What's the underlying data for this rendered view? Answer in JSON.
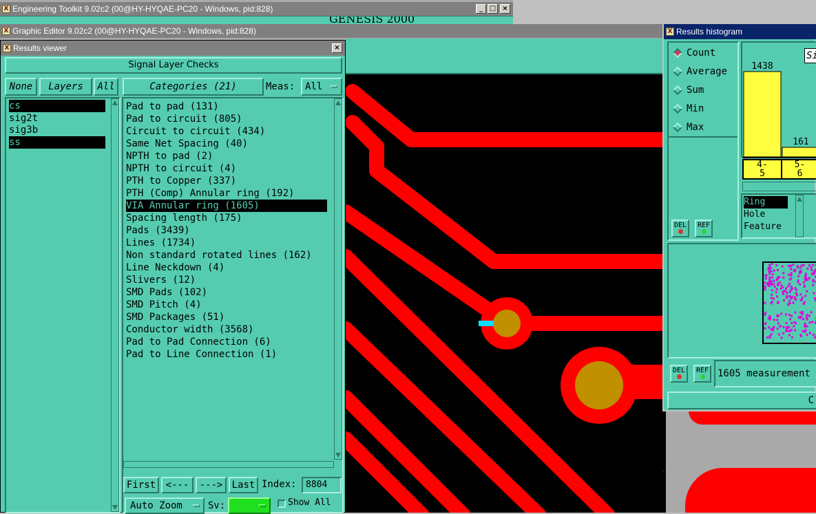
{
  "windows": {
    "toolkit_title": "Engineering Toolkit 9.02c2 (00@HY-HYQAE-PC20 - Windows, pid:828)",
    "editor_title": "Graphic Editor 9.02c2 (00@HY-HYQAE-PC20 - Windows, pid:828)",
    "behind_text": "GENESIS 2000",
    "viewer_title": "Results viewer",
    "histogram_title": "Results histogram"
  },
  "viewer": {
    "header": "Signal Layer Checks",
    "none_label": "None",
    "layers_label": "Layers",
    "all_label": "All",
    "categories_label": "Categories (21)",
    "meas_label": "Meas:",
    "meas_value": "All",
    "layers": [
      {
        "name": "cs",
        "selected": true
      },
      {
        "name": "sig2t",
        "selected": false
      },
      {
        "name": "sig3b",
        "selected": false
      },
      {
        "name": "ss",
        "selected": true
      }
    ],
    "categories": [
      {
        "label": "Pad to pad (131)",
        "selected": false
      },
      {
        "label": "Pad to circuit (805)",
        "selected": false
      },
      {
        "label": "Circuit to circuit (434)",
        "selected": false
      },
      {
        "label": "Same Net Spacing (40)",
        "selected": false
      },
      {
        "label": "NPTH to pad (2)",
        "selected": false
      },
      {
        "label": "NPTH to circuit (4)",
        "selected": false
      },
      {
        "label": "PTH to Copper (337)",
        "selected": false
      },
      {
        "label": "PTH (Comp) Annular ring (192)",
        "selected": false
      },
      {
        "label": "VIA Annular ring (1605)",
        "selected": true
      },
      {
        "label": "Spacing length (175)",
        "selected": false
      },
      {
        "label": "Pads (3439)",
        "selected": false
      },
      {
        "label": "Lines (1734)",
        "selected": false
      },
      {
        "label": "Non standard rotated lines (162)",
        "selected": false
      },
      {
        "label": "Line Neckdown (4)",
        "selected": false
      },
      {
        "label": "Slivers (12)",
        "selected": false
      },
      {
        "label": "SMD Pads (102)",
        "selected": false
      },
      {
        "label": "SMD Pitch (4)",
        "selected": false
      },
      {
        "label": "SMD Packages (51)",
        "selected": false
      },
      {
        "label": "Conductor width (3568)",
        "selected": false
      },
      {
        "label": "Pad to Pad Connection (6)",
        "selected": false
      },
      {
        "label": "Pad to Line Connection (1)",
        "selected": false
      }
    ],
    "first_label": "First",
    "prev_label": "<---",
    "next_label": "--->",
    "last_label": "Last",
    "index_label": "Index:",
    "index_value": "8804",
    "autozoom_label": "Auto Zoom",
    "sv_label": "Sv:",
    "show_all_label": "Show All"
  },
  "histogram": {
    "modes": [
      {
        "label": "Count",
        "selected": true
      },
      {
        "label": "Average",
        "selected": false
      },
      {
        "label": "Sum",
        "selected": false
      },
      {
        "label": "Min",
        "selected": false
      },
      {
        "label": "Max",
        "selected": false
      }
    ],
    "chart_data": {
      "type": "bar",
      "categories": [
        "4-5",
        "5-6"
      ],
      "values": [
        1438,
        161
      ]
    },
    "cat_1": "4-\n5",
    "cat_2": "5-\n6",
    "tab_partial": "Si",
    "measure_types": [
      {
        "label": "Ring",
        "selected": true
      },
      {
        "label": "Hole",
        "selected": false
      },
      {
        "label": "Feature",
        "selected": false
      }
    ],
    "del_label": "DEL",
    "ref_label": "REF",
    "status": "1605 measurement",
    "bottom_partial": "C"
  },
  "colors": {
    "teal": "#55ccb0",
    "copper": "#ff0000",
    "pad_center": "#c09000",
    "measure_marker": "#00e0ff",
    "bar": "#ffff40",
    "map_dots": "#e000e0"
  }
}
